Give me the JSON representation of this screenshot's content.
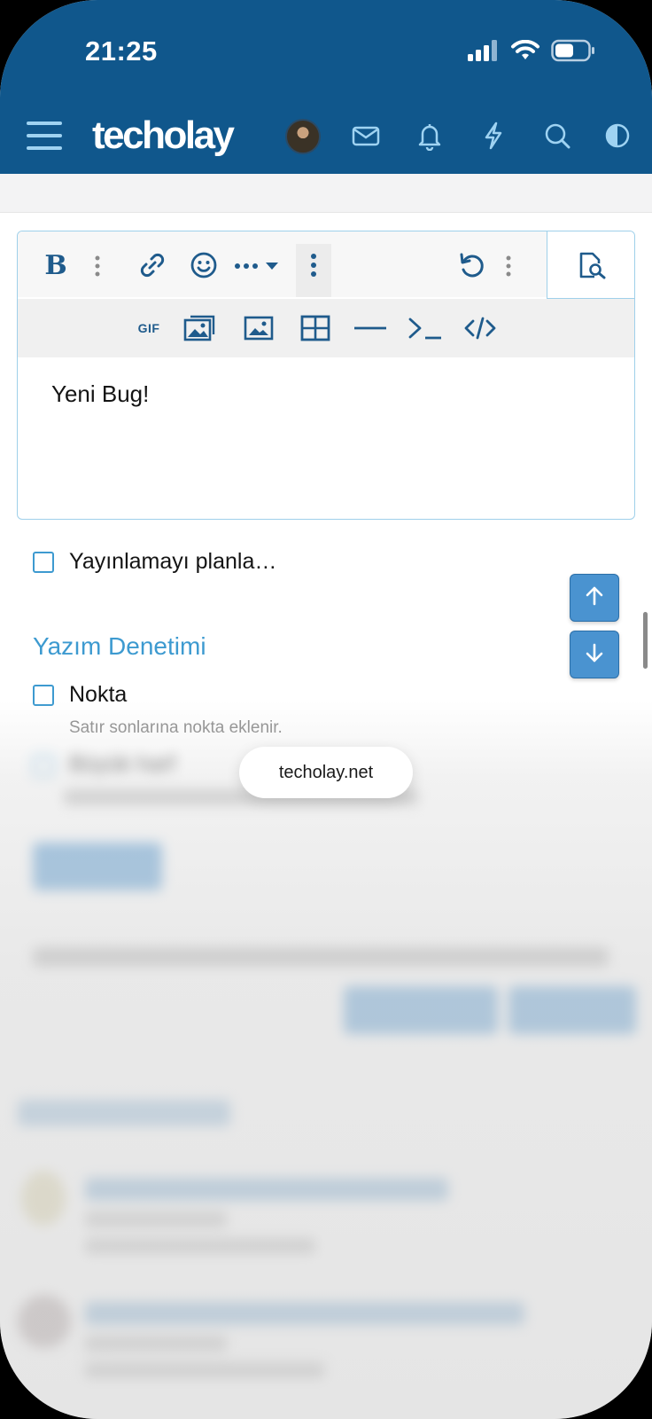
{
  "status_bar": {
    "time": "21:25"
  },
  "nav": {
    "site_name": "techolay",
    "icons": [
      "menu-icon",
      "avatar",
      "mail-icon",
      "bell-icon",
      "lightning-icon",
      "search-icon",
      "theme-toggle-icon"
    ]
  },
  "editor": {
    "toolbar_icons": [
      "bold-icon",
      "more-vertical-icon",
      "link-icon",
      "smiley-icon",
      "more-horizontal-icon",
      "more-vertical-icon",
      "undo-icon",
      "more-vertical-icon",
      "preview-icon"
    ],
    "toolbar2_icons": [
      "gif-icon",
      "media-gallery-icon",
      "image-icon",
      "table-icon",
      "horizontal-line-icon",
      "code-inline-icon",
      "code-block-icon"
    ],
    "bold_label": "B",
    "gif_label": "GIF",
    "text": "Yeni Bug!"
  },
  "schedule": {
    "label": "Yayınlamayı planla…",
    "checked": false
  },
  "spellcheck": {
    "title": "Yazım Denetimi",
    "options": [
      {
        "label": "Nokta",
        "hint": "Satır sonlarına nokta eklenir.",
        "checked": false
      },
      {
        "label": "Büyük harf",
        "checked": false
      }
    ]
  },
  "scroll_buttons": {
    "up": "arrow-up-icon",
    "down": "arrow-down-icon"
  },
  "url_pill": "techolay.net",
  "colors": {
    "header": "#10578c",
    "accent": "#3d9ad0",
    "button": "#4a93d0"
  }
}
